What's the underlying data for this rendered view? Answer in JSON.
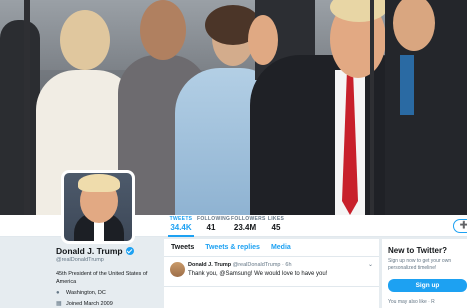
{
  "header_photo": {
    "alt": ""
  },
  "profile_nav": {
    "stats": [
      {
        "label": "TWEETS",
        "value": "34.4K",
        "active": true
      },
      {
        "label": "FOLLOWING",
        "value": "41",
        "active": false
      },
      {
        "label": "FOLLOWERS",
        "value": "23.4M",
        "active": false
      },
      {
        "label": "LIKES",
        "value": "45",
        "active": false
      }
    ]
  },
  "profile": {
    "name": "Donald J. Trump",
    "handle": "@realDonaldTrump",
    "bio": "45th President of the United States of America",
    "location": "Washington, DC",
    "joined": "Joined March 2009"
  },
  "timeline": {
    "tabs": [
      "Tweets",
      "Tweets & replies",
      "Media"
    ],
    "tweet": {
      "name": "Donald J. Trump",
      "handle": "@realDonaldTrump",
      "time": "· 6h",
      "text": "Thank you, @Samsung! We would love to have you!"
    }
  },
  "sidebar": {
    "title": "New to Twitter?",
    "text": "Sign up now to get your own personalized timeline!",
    "signup_label": "Sign up",
    "footer": "You may also like · R"
  },
  "colors": {
    "accent": "#1da1f2",
    "background": "#e6ecf0",
    "text": "#14171a",
    "muted": "#657786"
  }
}
